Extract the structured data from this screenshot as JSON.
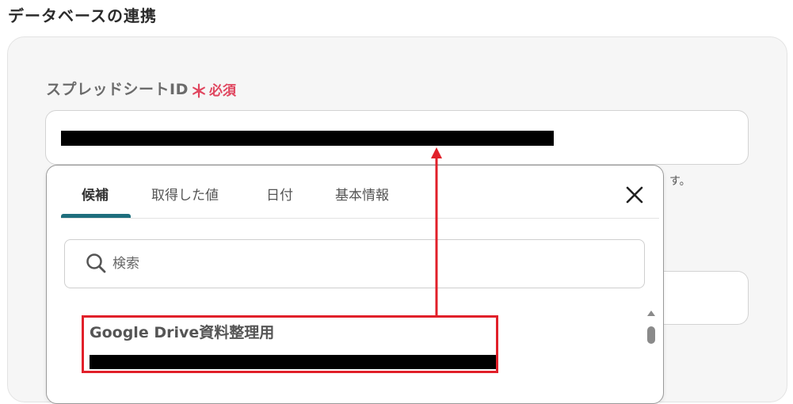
{
  "section": {
    "title": "データベースの連携"
  },
  "field": {
    "label": "スプレッドシートID",
    "required_star": "＊",
    "required_text": "必須",
    "hint_tail": "す。"
  },
  "popup": {
    "tabs": [
      {
        "label": "候補",
        "active": true
      },
      {
        "label": "取得した値",
        "active": false
      },
      {
        "label": "日付",
        "active": false
      },
      {
        "label": "基本情報",
        "active": false
      }
    ],
    "search": {
      "placeholder": "検索",
      "value": ""
    },
    "items": [
      {
        "title": "Google Drive資料整理用"
      }
    ]
  },
  "colors": {
    "accent": "#1e6e7d",
    "required": "#e0465f",
    "annotation": "#e1202a"
  },
  "icons": {
    "close": "close-icon",
    "search": "search-icon",
    "scroll_up": "triangle-up-icon"
  }
}
